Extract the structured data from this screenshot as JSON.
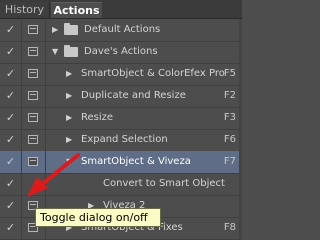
{
  "tabs": {
    "history": "History",
    "actions": "Actions"
  },
  "rows": [
    {
      "check": "✓",
      "label": "Default Actions",
      "key": "",
      "type": "folder",
      "expanded": false
    },
    {
      "check": "✓",
      "label": "Dave's Actions",
      "key": "",
      "type": "folder",
      "expanded": true
    },
    {
      "check": "✓",
      "label": "SmartObject & ColorEfex Pro",
      "key": "F5",
      "type": "action",
      "expanded": false
    },
    {
      "check": "✓",
      "label": "Duplicate and Resize",
      "key": "F2",
      "type": "action",
      "expanded": false
    },
    {
      "check": "✓",
      "label": "Resize",
      "key": "F3",
      "type": "action",
      "expanded": false
    },
    {
      "check": "✓",
      "label": "Expand Selection",
      "key": "F6",
      "type": "action",
      "expanded": false
    },
    {
      "check": "✓",
      "label": "SmartObject & Viveza",
      "key": "F7",
      "type": "action",
      "expanded": true,
      "selected": true
    },
    {
      "check": "✓",
      "label": "Convert to Smart Object",
      "key": "",
      "type": "step",
      "expanded": false
    },
    {
      "check": "✓",
      "label": "Viveza 2",
      "key": "",
      "type": "step",
      "expanded": false
    },
    {
      "check": "✓",
      "label": "SmartObject & Fixes",
      "key": "F8",
      "type": "action",
      "expanded": false
    }
  ],
  "tooltip": "Toggle dialog on/off",
  "colors": {
    "panel_bg": "#4d4d4d",
    "selected_row": "#5f6d86",
    "tooltip_bg": "#fbfbc6",
    "arrow": "#e0191b"
  },
  "icons": [
    "check-icon",
    "dialog-toggle-icon",
    "expand-triangle-icon",
    "folder-icon"
  ]
}
